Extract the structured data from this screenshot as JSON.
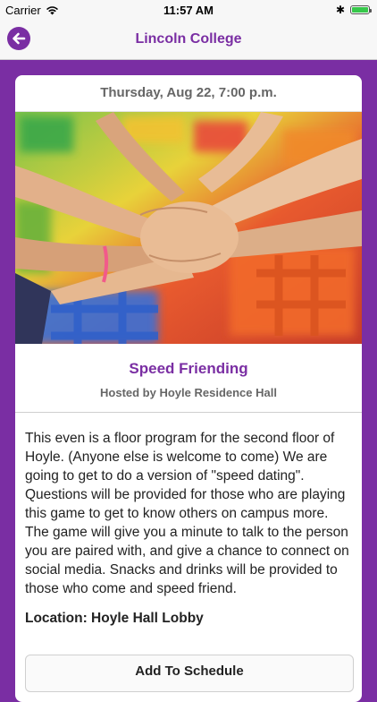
{
  "status": {
    "carrier": "Carrier",
    "time": "11:57 AM",
    "battery_level": 1.0
  },
  "nav": {
    "title": "Lincoln College",
    "back_icon": "back-arrow-icon"
  },
  "event": {
    "date": "Thursday, Aug 22, 7:00 p.m.",
    "title": "Speed Friending",
    "host": "Hosted by Hoyle Residence Hall",
    "description": "This even is a floor program for the second floor of Hoyle. (Anyone else is welcome to come) We are going to get to do a version of \"speed dating\". Questions will be provided for those who are playing this game to get to know others on campus more. The game will give you a minute to talk to the person you are paired with, and give a chance to connect on social media. Snacks and drinks will be provided to those who come and speed friend.",
    "location": "Location: Hoyle Hall Lobby",
    "button_label": "Add To Schedule"
  },
  "colors": {
    "brand": "#7a2ea3",
    "battery": "#37c84b"
  }
}
